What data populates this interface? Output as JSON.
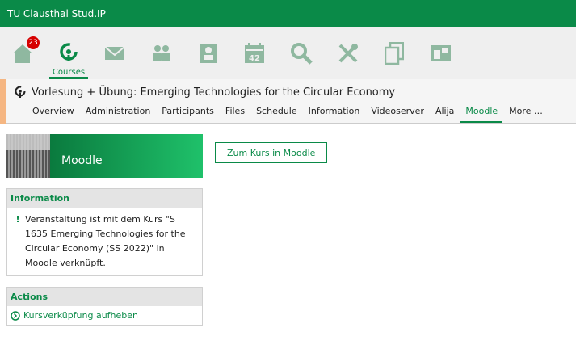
{
  "app": {
    "title": "TU Clausthal Stud.IP"
  },
  "navbar": {
    "items": [
      {
        "icon": "home-icon",
        "badge": "23"
      },
      {
        "icon": "courses-icon",
        "label": "Courses",
        "active": true
      },
      {
        "icon": "messages-icon"
      },
      {
        "icon": "community-icon"
      },
      {
        "icon": "profile-icon"
      },
      {
        "icon": "calendar-icon"
      },
      {
        "icon": "search-icon"
      },
      {
        "icon": "tools-icon"
      },
      {
        "icon": "files-icon"
      },
      {
        "icon": "admin-icon"
      }
    ]
  },
  "context": {
    "title": "Vorlesung + Übung: Emerging Technologies for the Circular Economy",
    "tabs": [
      {
        "label": "Overview"
      },
      {
        "label": "Administration"
      },
      {
        "label": "Participants"
      },
      {
        "label": "Files"
      },
      {
        "label": "Schedule"
      },
      {
        "label": "Information"
      },
      {
        "label": "Videoserver"
      },
      {
        "label": "Alija"
      },
      {
        "label": "Moodle",
        "active": true
      },
      {
        "label": "More …"
      }
    ]
  },
  "sidebar": {
    "header_title": "Moodle",
    "info": {
      "title": "Information",
      "text": "Veranstaltung ist mit dem Kurs \"S 1635 Emerging Technologies for the Circular Economy (SS 2022)\" in Moodle verknüpft."
    },
    "actions": {
      "title": "Actions",
      "items": [
        {
          "label": "Kursverküpfung aufheben"
        }
      ]
    }
  },
  "main": {
    "button_label": "Zum Kurs in Moodle"
  },
  "colors": {
    "primary": "#0a8a48",
    "accent": "#f5b682",
    "badge": "#d60000"
  }
}
